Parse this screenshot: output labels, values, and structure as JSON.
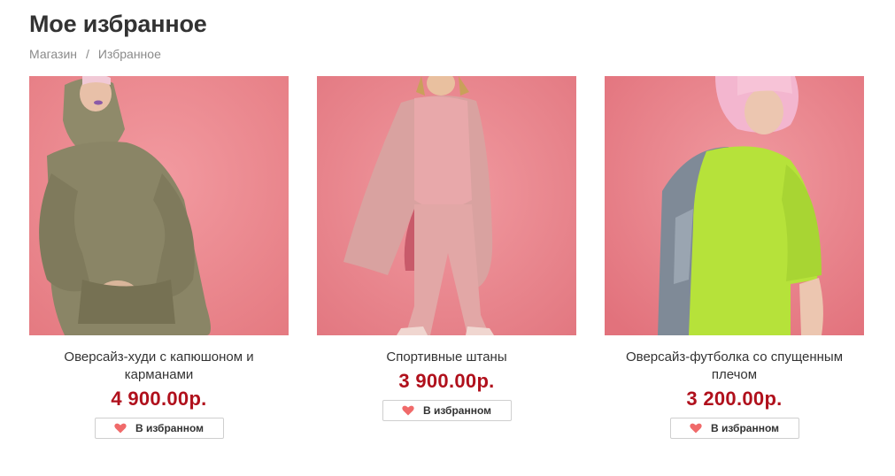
{
  "page": {
    "title": "Мое избранное",
    "breadcrumb": [
      {
        "label": "Магазин"
      },
      {
        "label": "Избранное"
      }
    ],
    "breadcrumb_separator": "/"
  },
  "products": [
    {
      "name": "Оверсайз-худи с капюшоном и карманами",
      "price": "4 900.00р.",
      "favorite_label": "В избранном",
      "image": "model-khaki-hoodie-pink-background"
    },
    {
      "name": "Спортивные штаны",
      "price": "3 900.00р.",
      "favorite_label": "В избранном",
      "image": "model-pink-sweatsuit-coat-pink-background"
    },
    {
      "name": "Оверсайз-футболка со спущенным плечом",
      "price": "3 200.00р.",
      "favorite_label": "В избранном",
      "image": "model-lime-tshirt-pink-wig-pink-background"
    }
  ],
  "colors": {
    "price": "#b0101c",
    "heart": "#f06a6a",
    "photo_background": "#ef8a8e"
  },
  "icons": {
    "favorite": "heart-icon"
  }
}
